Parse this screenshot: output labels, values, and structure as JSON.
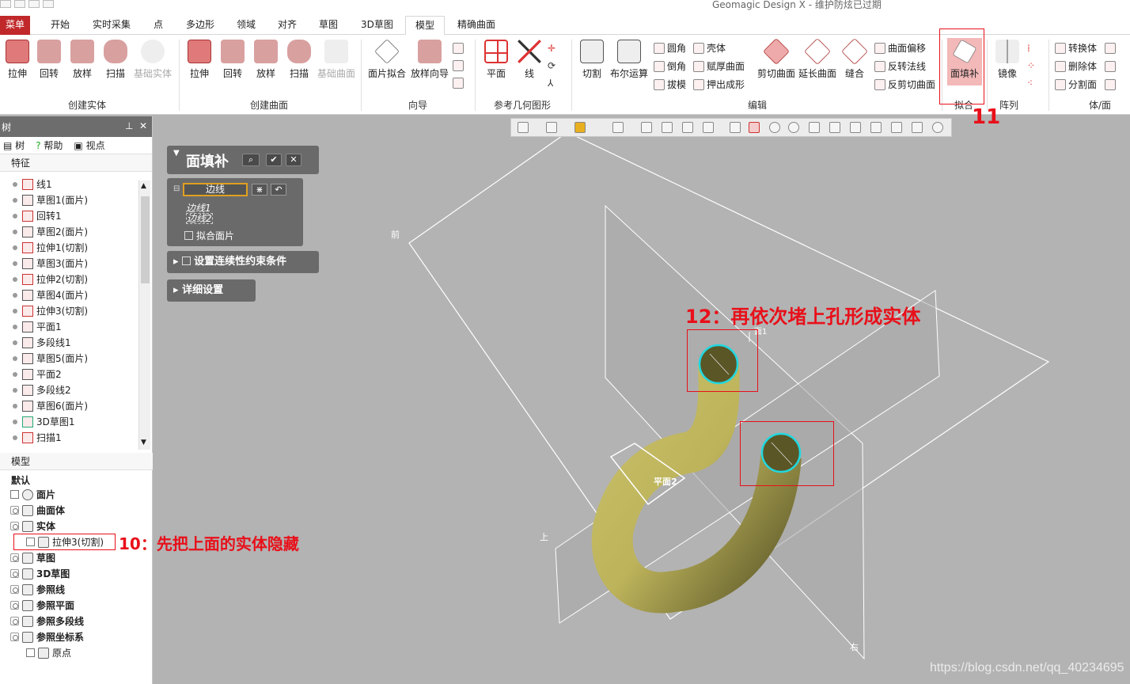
{
  "app": {
    "title": "Geomagic Design X - 维护防炫已过期"
  },
  "tabs": [
    "菜单",
    "开始",
    "实时采集",
    "点",
    "多边形",
    "领域",
    "对齐",
    "草图",
    "3D草图",
    "模型",
    "精确曲面"
  ],
  "ribbon": {
    "create_solid": {
      "label": "创建实体",
      "buttons": [
        "拉伸",
        "回转",
        "放样",
        "扫描",
        "基础实体"
      ]
    },
    "create_surface": {
      "label": "创建曲面",
      "buttons": [
        "拉伸",
        "回转",
        "放样",
        "扫描",
        "基础曲面"
      ]
    },
    "wizard": {
      "label": "向导",
      "buttons": [
        "面片拟合",
        "放样向导"
      ]
    },
    "ref_geometry": {
      "label": "参考几何图形",
      "buttons": [
        "平面",
        "线"
      ]
    },
    "edit": {
      "label": "编辑",
      "big": [
        "切割",
        "布尔运算",
        "剪切曲面",
        "延长曲面",
        "缝合"
      ],
      "small": [
        "圆角",
        "倒角",
        "拔模",
        "壳体",
        "赋厚曲面",
        "押出成形",
        "曲面偏移",
        "反转法线",
        "反剪切曲面"
      ]
    },
    "fit": {
      "label": "拟合",
      "button": "面填补"
    },
    "array": {
      "label": "阵列",
      "button": "镜像"
    },
    "body_face": {
      "label": "体/面",
      "small": [
        "转换体",
        "删除体",
        "分割面"
      ]
    }
  },
  "left_panel": {
    "header": "树",
    "subtabs": [
      "树",
      "帮助",
      "视点"
    ],
    "feature_section": "特征",
    "features": [
      "线1",
      "草图1(面片)",
      "回转1",
      "草图2(面片)",
      "拉伸1(切割)",
      "草图3(面片)",
      "拉伸2(切割)",
      "草图4(面片)",
      "拉伸3(切割)",
      "平面1",
      "多段线1",
      "草图5(面片)",
      "平面2",
      "多段线2",
      "草图6(面片)",
      "3D草图1",
      "扫描1"
    ],
    "model_section": "模型",
    "model_default": "默认",
    "model_items": [
      "面片",
      "曲面体",
      "实体",
      "拉伸3(切割)",
      "草图",
      "3D草图",
      "参照线",
      "参照平面",
      "参照多段线",
      "参照坐标系",
      "原点"
    ]
  },
  "dialog": {
    "title": "面填补",
    "edge_label": "边线",
    "edges": [
      "边线1",
      "边线2"
    ],
    "fit_patch": "拟合面片",
    "continuity": "设置连续性约束条件",
    "details": "详细设置"
  },
  "viewport": {
    "labels": {
      "front": "前",
      "top": "上",
      "right": "右",
      "plane": "平面2",
      "other": "面1"
    }
  },
  "annotations": {
    "a10": "10：先把上面的实体隐藏",
    "a11": "11",
    "a12": "12：再依次堵上孔形成实体"
  },
  "watermark": "https://blog.csdn.net/qq_40234695"
}
